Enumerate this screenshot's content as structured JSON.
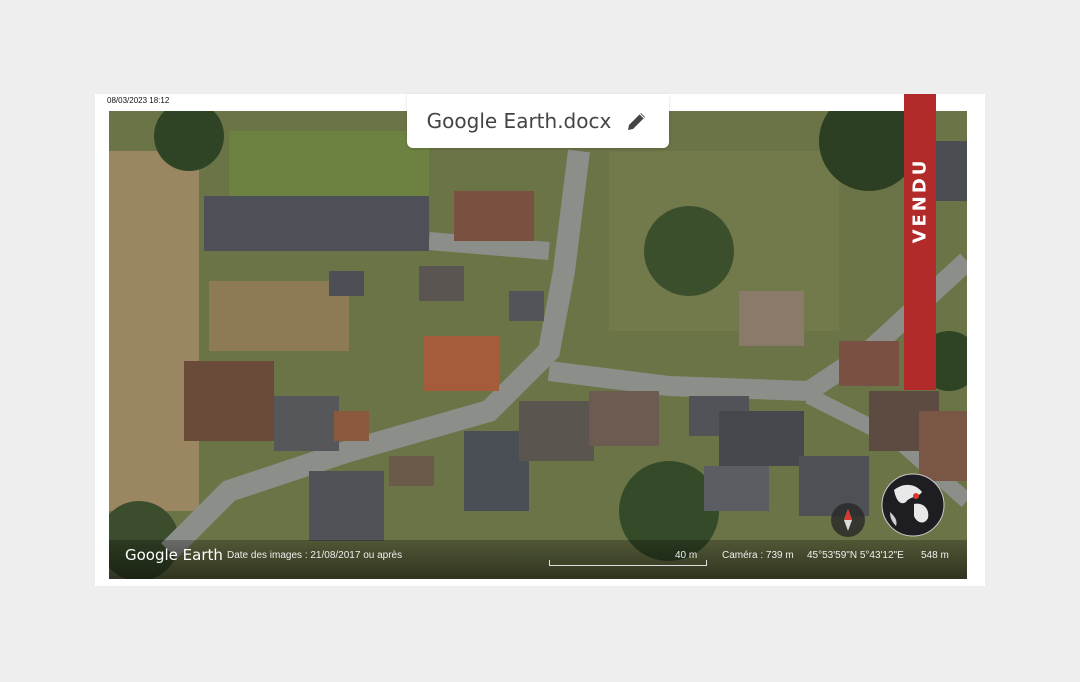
{
  "timestamp": "08/03/2023 18:12",
  "document": {
    "name": "Google Earth.docx",
    "edit_icon": "pencil-icon"
  },
  "sold_banner": {
    "text": "VENDU",
    "color": "#b22a2a"
  },
  "map": {
    "logo": "Google Earth",
    "image_date": "Date des images : 21/08/2017 ou après",
    "scale": "40 m",
    "camera": "Caméra : 739 m",
    "coordinates": "45°53'59\"N 5°43'12\"E",
    "altitude": "548 m",
    "compass_icon": "compass-icon",
    "globe_icon": "globe-icon"
  }
}
